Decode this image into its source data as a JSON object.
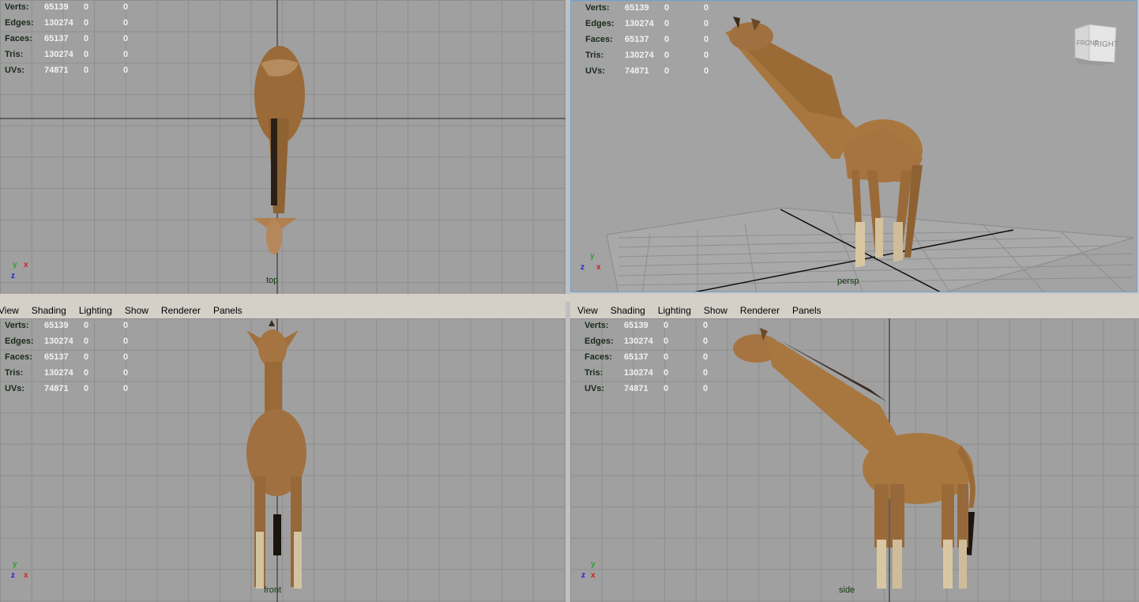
{
  "menu": [
    "View",
    "Shading",
    "Lighting",
    "Show",
    "Renderer",
    "Panels"
  ],
  "hud": {
    "labels": [
      "Verts:",
      "Edges:",
      "Faces:",
      "Tris:",
      "UVs:"
    ],
    "values": [
      [
        "65139",
        "0",
        "0"
      ],
      [
        "130274",
        "0",
        "0"
      ],
      [
        "65137",
        "0",
        "0"
      ],
      [
        "130274",
        "0",
        "0"
      ],
      [
        "74871",
        "0",
        "0"
      ]
    ]
  },
  "viewports": {
    "top": "top",
    "persp": "persp",
    "front": "front",
    "side": "side"
  },
  "axes": {
    "x": "x",
    "y": "y",
    "z": "z"
  },
  "view_cube": {
    "front": "FRONT",
    "right": "RIGHT"
  },
  "colors": {
    "x_axis": "#d42020",
    "y_axis": "#2ea02e",
    "z_axis": "#2020d0",
    "viewport_bg": "#a0a0a0",
    "grid": "#8e8e8e",
    "grid_axis": "#202020"
  }
}
